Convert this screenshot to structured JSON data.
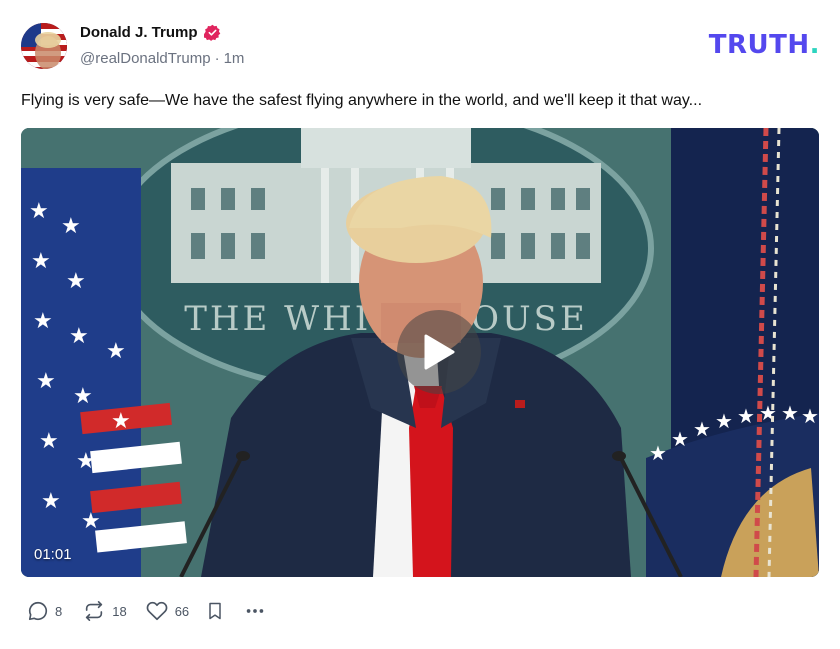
{
  "author": {
    "display_name": "Donald J. Trump",
    "handle": "@realDonaldTrump",
    "separator": "·",
    "time_ago": "1m",
    "verified_badge_color": "#e0245e"
  },
  "brand": {
    "logo_text": "TRUTH",
    "logo_dot": ".",
    "logo_color": "#5448ee",
    "logo_dot_color": "#2dd4bf"
  },
  "post": {
    "text": "Flying is very safe—We have the safest flying anywhere in the world, and we'll keep it that way..."
  },
  "video": {
    "duration": "01:01",
    "play_icon": "play-icon",
    "seal_text": "THE WHITE HOUSE"
  },
  "actions": {
    "reply_count": "8",
    "retruth_count": "18",
    "like_count": "66",
    "icons": [
      "reply-icon",
      "retruth-icon",
      "heart-icon",
      "bookmark-icon",
      "more-icon"
    ]
  }
}
